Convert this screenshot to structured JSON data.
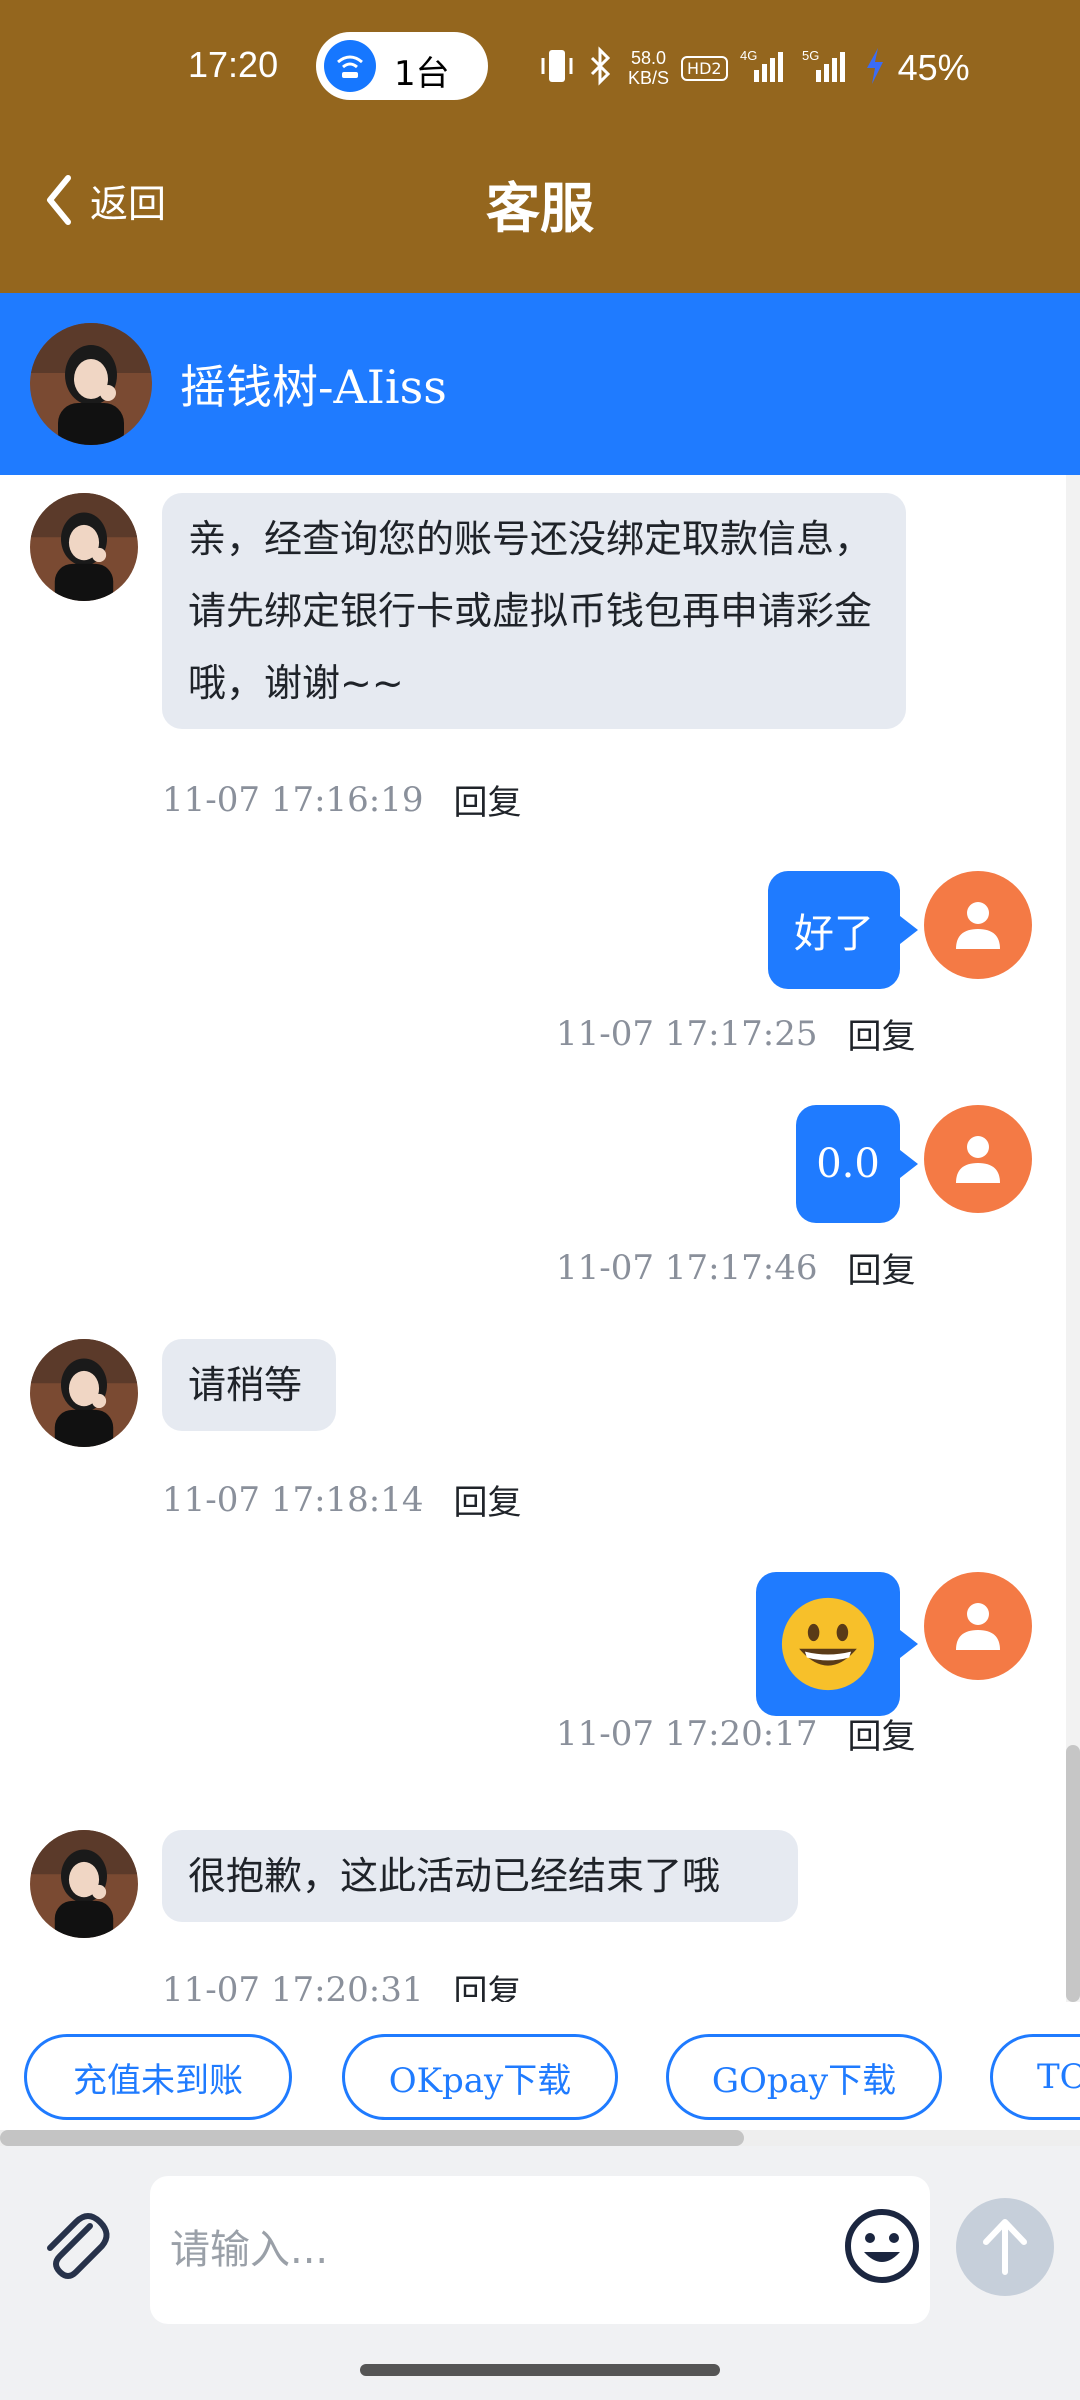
{
  "status_bar": {
    "time": "17:20",
    "hotspot_count": "1台",
    "net_speed_value": "58.0",
    "net_speed_unit": "KB/S",
    "hd_badge": "HD2",
    "signal_1": "4G",
    "signal_2": "5G",
    "battery": "45%"
  },
  "nav": {
    "back_label": "返回",
    "title": "客服"
  },
  "agent": {
    "name": "摇钱树-AIiss"
  },
  "messages": [
    {
      "side": "in",
      "text": "亲，经查询您的账号还没绑定取款信息，请先绑定银行卡或虚拟币钱包再申请彩金哦，谢谢~~",
      "time": "11-07 17:16:19",
      "reply": "回复"
    },
    {
      "side": "out",
      "text": "好了",
      "time": "11-07 17:17:25",
      "reply": "回复"
    },
    {
      "side": "out",
      "text": "0.0",
      "time": "11-07 17:17:46",
      "reply": "回复"
    },
    {
      "side": "in",
      "text": "请稍等",
      "time": "11-07 17:18:14",
      "reply": "回复"
    },
    {
      "side": "out",
      "text": "grinning-emoji",
      "time": "11-07 17:20:17",
      "reply": "回复"
    },
    {
      "side": "in",
      "text": "很抱歉，这此活动已经结束了哦",
      "time": "11-07 17:20:31",
      "reply": "回复"
    }
  ],
  "quick_replies": [
    "充值未到账",
    "OKpay下载",
    "GOpay下载",
    "TO"
  ],
  "input": {
    "placeholder": "请输入..."
  },
  "colors": {
    "header": "#94661e",
    "accent": "#1f7bff",
    "user_avatar": "#f47a45",
    "incoming_bubble": "#e6eaf1"
  }
}
